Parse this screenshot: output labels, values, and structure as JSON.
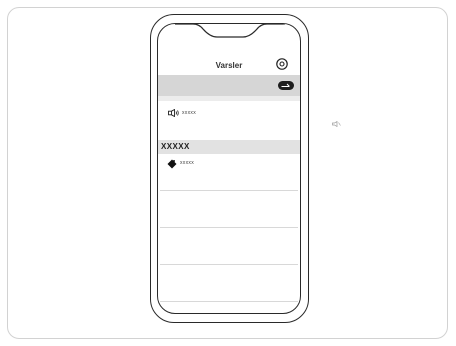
{
  "screen": {
    "title": "Varsler",
    "settings_icon": "gear-icon",
    "toggle_icon": "arrow-right-icon",
    "rows": [
      {
        "icon": "speaker-icon",
        "label": "xxxxx"
      }
    ],
    "section": {
      "heading": "XXXXX",
      "rows": [
        {
          "icon": "tag-icon",
          "label": "xxxxx"
        }
      ]
    },
    "empty_rows": 3
  },
  "colors": {
    "toggle_bar": "#d6d6d6",
    "section_bar": "#e2e2e2",
    "outline": "#2a2a2a"
  }
}
